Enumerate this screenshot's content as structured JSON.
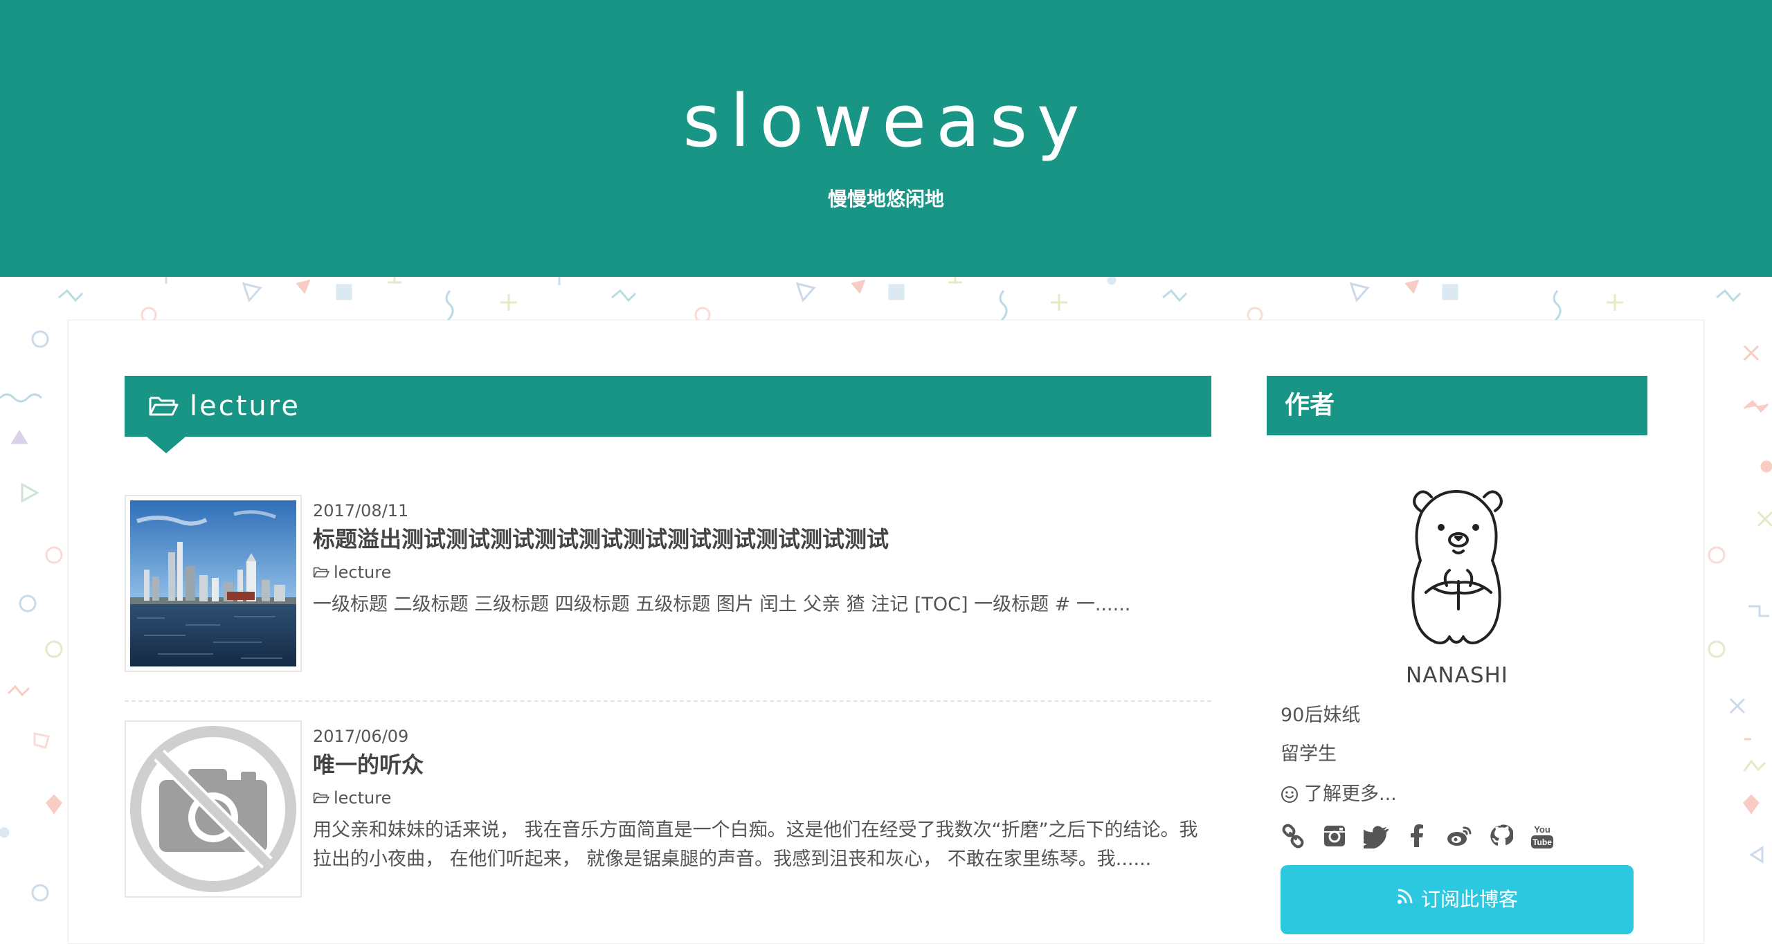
{
  "site": {
    "title": "sloweasy",
    "subtitle": "慢慢地悠闲地"
  },
  "section": {
    "title": "lecture",
    "icon": "folder-open-icon"
  },
  "posts": [
    {
      "date": "2017/08/11",
      "title": "标题溢出测试测试测试测试测试测试测试测试测试测试测试",
      "category": "lecture",
      "excerpt": "一级标题 二级标题 三级标题 四级标题 五级标题 图片 闰土 父亲 猹 注记 [TOC] 一级标题 # 一......",
      "thumb": "harbor-photo"
    },
    {
      "date": "2017/06/09",
      "title": "唯一的听众",
      "category": "lecture",
      "excerpt": "用父亲和妹妹的话来说， 我在音乐方面简直是一个白痴。这是他们在经受了我数次“折磨”之后下的结论。我拉出的小夜曲， 在他们听起来， 就像是锯桌腿的声音。我感到沮丧和灰心， 不敢在家里练琴。我......",
      "thumb": "no-image-icon"
    }
  ],
  "sidebar": {
    "widget_title": "作者",
    "author_name": "NANASHI",
    "bio": [
      "90后妹纸",
      "留学生"
    ],
    "more_label": "了解更多...",
    "social_icons": [
      "link-icon",
      "instagram-icon",
      "twitter-icon",
      "facebook-icon",
      "weibo-icon",
      "github-icon",
      "youtube-icon"
    ],
    "subscribe_label": "订阅此博客"
  },
  "colors": {
    "brand": "#189585",
    "subscribe": "#2bc8e0"
  }
}
